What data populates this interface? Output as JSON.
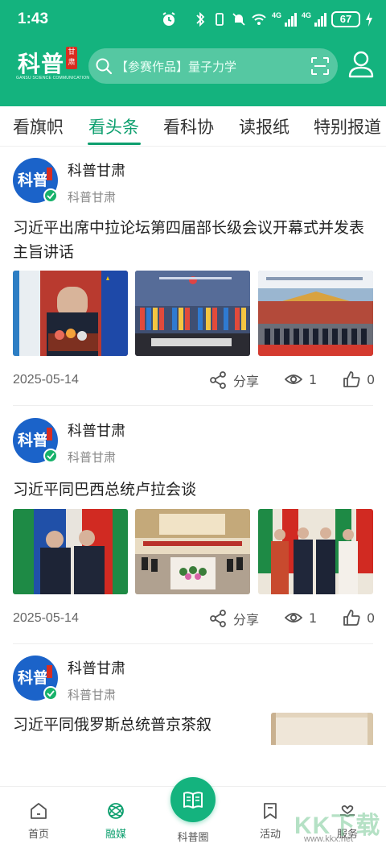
{
  "status_bar": {
    "time": "1:43",
    "network_label_1": "4G",
    "network_label_2": "4G",
    "battery": "67"
  },
  "header": {
    "logo_text": "科普",
    "logo_seal": "甘肃",
    "logo_subtitle": "GANSU SCIENCE COMMUNICATION",
    "search_placeholder": "【参赛作品】量子力学"
  },
  "tabs": [
    {
      "label": "看旗帜"
    },
    {
      "label": "看头条"
    },
    {
      "label": "看科协"
    },
    {
      "label": "读报纸"
    },
    {
      "label": "特别报道"
    }
  ],
  "feed": [
    {
      "author": "科普甘肃",
      "source": "科普甘肃",
      "title": "习近平出席中拉论坛第四届部长级会议开幕式并发表主旨讲话",
      "date": "2025-05-14",
      "share_label": "分享",
      "views": "1",
      "likes": "0"
    },
    {
      "author": "科普甘肃",
      "source": "科普甘肃",
      "title": "习近平同巴西总统卢拉会谈",
      "date": "2025-05-14",
      "share_label": "分享",
      "views": "1",
      "likes": "0"
    },
    {
      "author": "科普甘肃",
      "source": "科普甘肃",
      "title": "习近平同俄罗斯总统普京茶叙"
    }
  ],
  "bottom_nav": [
    {
      "label": "首页",
      "icon": "home-icon"
    },
    {
      "label": "融媒",
      "icon": "media-icon"
    },
    {
      "label": "科普圈",
      "icon": "book-icon"
    },
    {
      "label": "活动",
      "icon": "bookmark-icon"
    },
    {
      "label": "服务",
      "icon": "heart-hand-icon"
    }
  ],
  "watermark": {
    "text": "KK下载",
    "url": "www.kkx.net"
  },
  "colors": {
    "brand_green": "#14b37e",
    "active_green": "#0d9f6e",
    "avatar_blue": "#1b63c9"
  }
}
